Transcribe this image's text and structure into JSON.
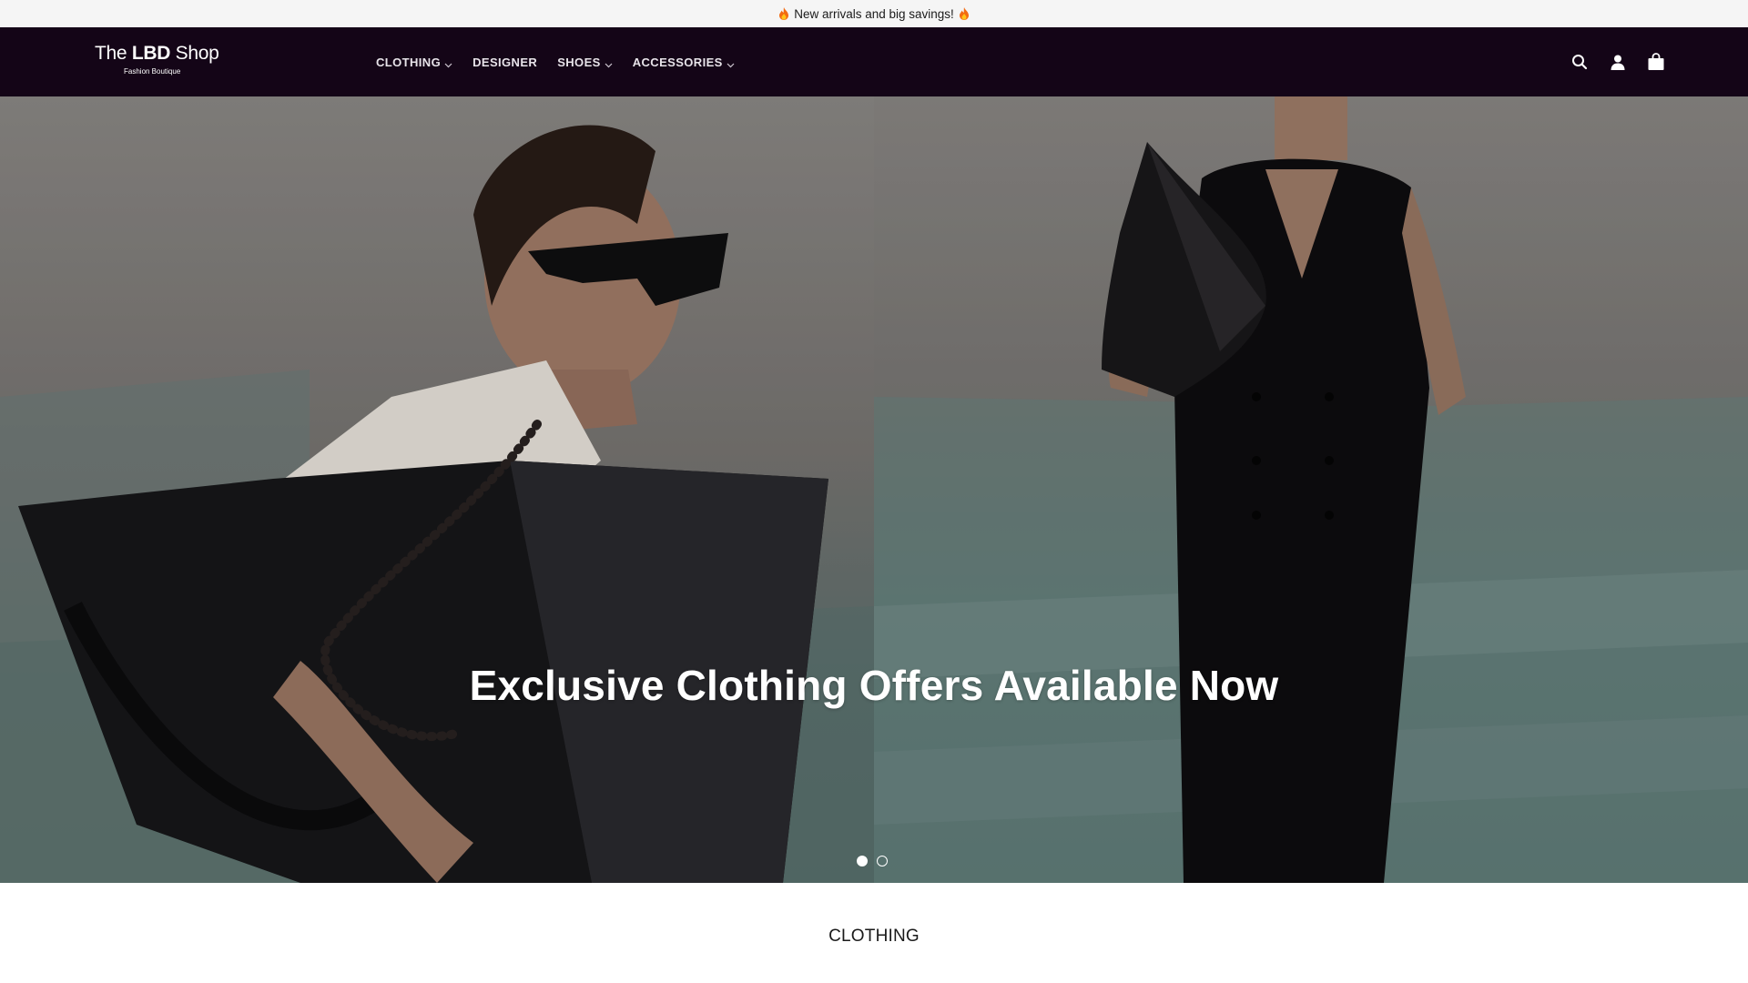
{
  "announcement": {
    "text": "New arrivals and big savings!",
    "icon": "flame-icon"
  },
  "header": {
    "logo": {
      "prefix": "The",
      "bold": "LBD",
      "suffix": "Shop",
      "tagline": "Fashion Boutique"
    },
    "nav": [
      {
        "label": "CLOTHING",
        "has_dropdown": true
      },
      {
        "label": "DESIGNER",
        "has_dropdown": false
      },
      {
        "label": "SHOES",
        "has_dropdown": true
      },
      {
        "label": "ACCESSORIES",
        "has_dropdown": true
      }
    ],
    "icons": [
      "search-icon",
      "account-icon",
      "cart-icon"
    ],
    "background": "#140517"
  },
  "hero": {
    "title": "Exclusive Clothing Offers Available Now",
    "slides_total": 2,
    "active_slide": 1
  },
  "section": {
    "title": "CLOTHING"
  }
}
